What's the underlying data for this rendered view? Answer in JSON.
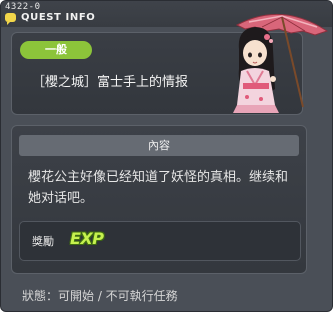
{
  "header": {
    "quest_id": "4322-0",
    "title": "QUEST INFO"
  },
  "info": {
    "category_badge": "一般",
    "quest_title": "［櫻之城］富士手上的情报"
  },
  "content": {
    "header": "內容",
    "description": "櫻花公主好像已经知道了妖怪的真相。继续和她对话吧。",
    "reward_label": "獎勵",
    "reward_icon_text": "EXP"
  },
  "status": {
    "text": "狀態：可開始 / 不可執行任務"
  },
  "colors": {
    "window_bg": "#4a4f57",
    "badge_green": "#8cc43a",
    "exp_green": "#c6f24e",
    "parasol_pink": "#d9667a"
  },
  "icons": [
    "dialog-icon",
    "exp-icon",
    "npc-character-sprite"
  ]
}
